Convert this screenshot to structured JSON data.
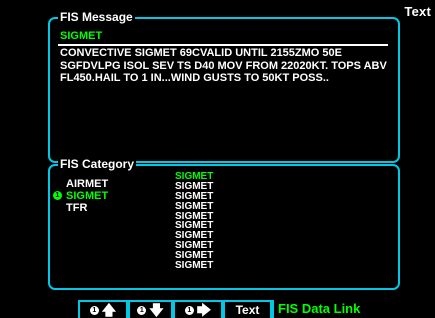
{
  "page": {
    "label": "Text"
  },
  "message_panel": {
    "title": "FIS Message",
    "heading": "SIGMET",
    "lines": [
      "CONVECTIVE SIGMET 69CVALID UNTIL 2155ZMO 50E",
      "SGFDVLPG ISOL SEV TS D40 MOV FROM 22020KT. TOPS ABV",
      "FL450.HAIL TO 1 IN...WIND GUSTS TO 50KT POSS.."
    ]
  },
  "category_panel": {
    "title": "FIS Category",
    "categories": [
      {
        "label": "AIRMET",
        "selected": false
      },
      {
        "label": "SIGMET",
        "selected": true
      },
      {
        "label": "TFR",
        "selected": false
      }
    ],
    "selected_marker": "1",
    "messages": [
      {
        "label": "SIGMET",
        "selected": true
      },
      {
        "label": "SIGMET",
        "selected": false
      },
      {
        "label": "SIGMET",
        "selected": false
      },
      {
        "label": "SIGMET",
        "selected": false
      },
      {
        "label": "SIGMET",
        "selected": false
      },
      {
        "label": "SIGMET",
        "selected": false
      },
      {
        "label": "SIGMET",
        "selected": false
      },
      {
        "label": "SIGMET",
        "selected": false
      },
      {
        "label": "SIGMET",
        "selected": false
      },
      {
        "label": "SIGMET",
        "selected": false
      }
    ]
  },
  "softkeys": {
    "key1": {
      "badge": "1",
      "arrow": "🡅",
      "icon": "up-arrow"
    },
    "key2": {
      "badge": "1",
      "arrow": "🡇",
      "icon": "down-arrow"
    },
    "key3": {
      "badge": "1",
      "arrow": "🡆",
      "icon": "right-arrow"
    },
    "text_label": "Text",
    "page_title": "FIS Data Link"
  },
  "colors": {
    "border": "#00c8e6",
    "highlight": "#00ff00",
    "text": "#ffffff",
    "background": "#000000"
  }
}
